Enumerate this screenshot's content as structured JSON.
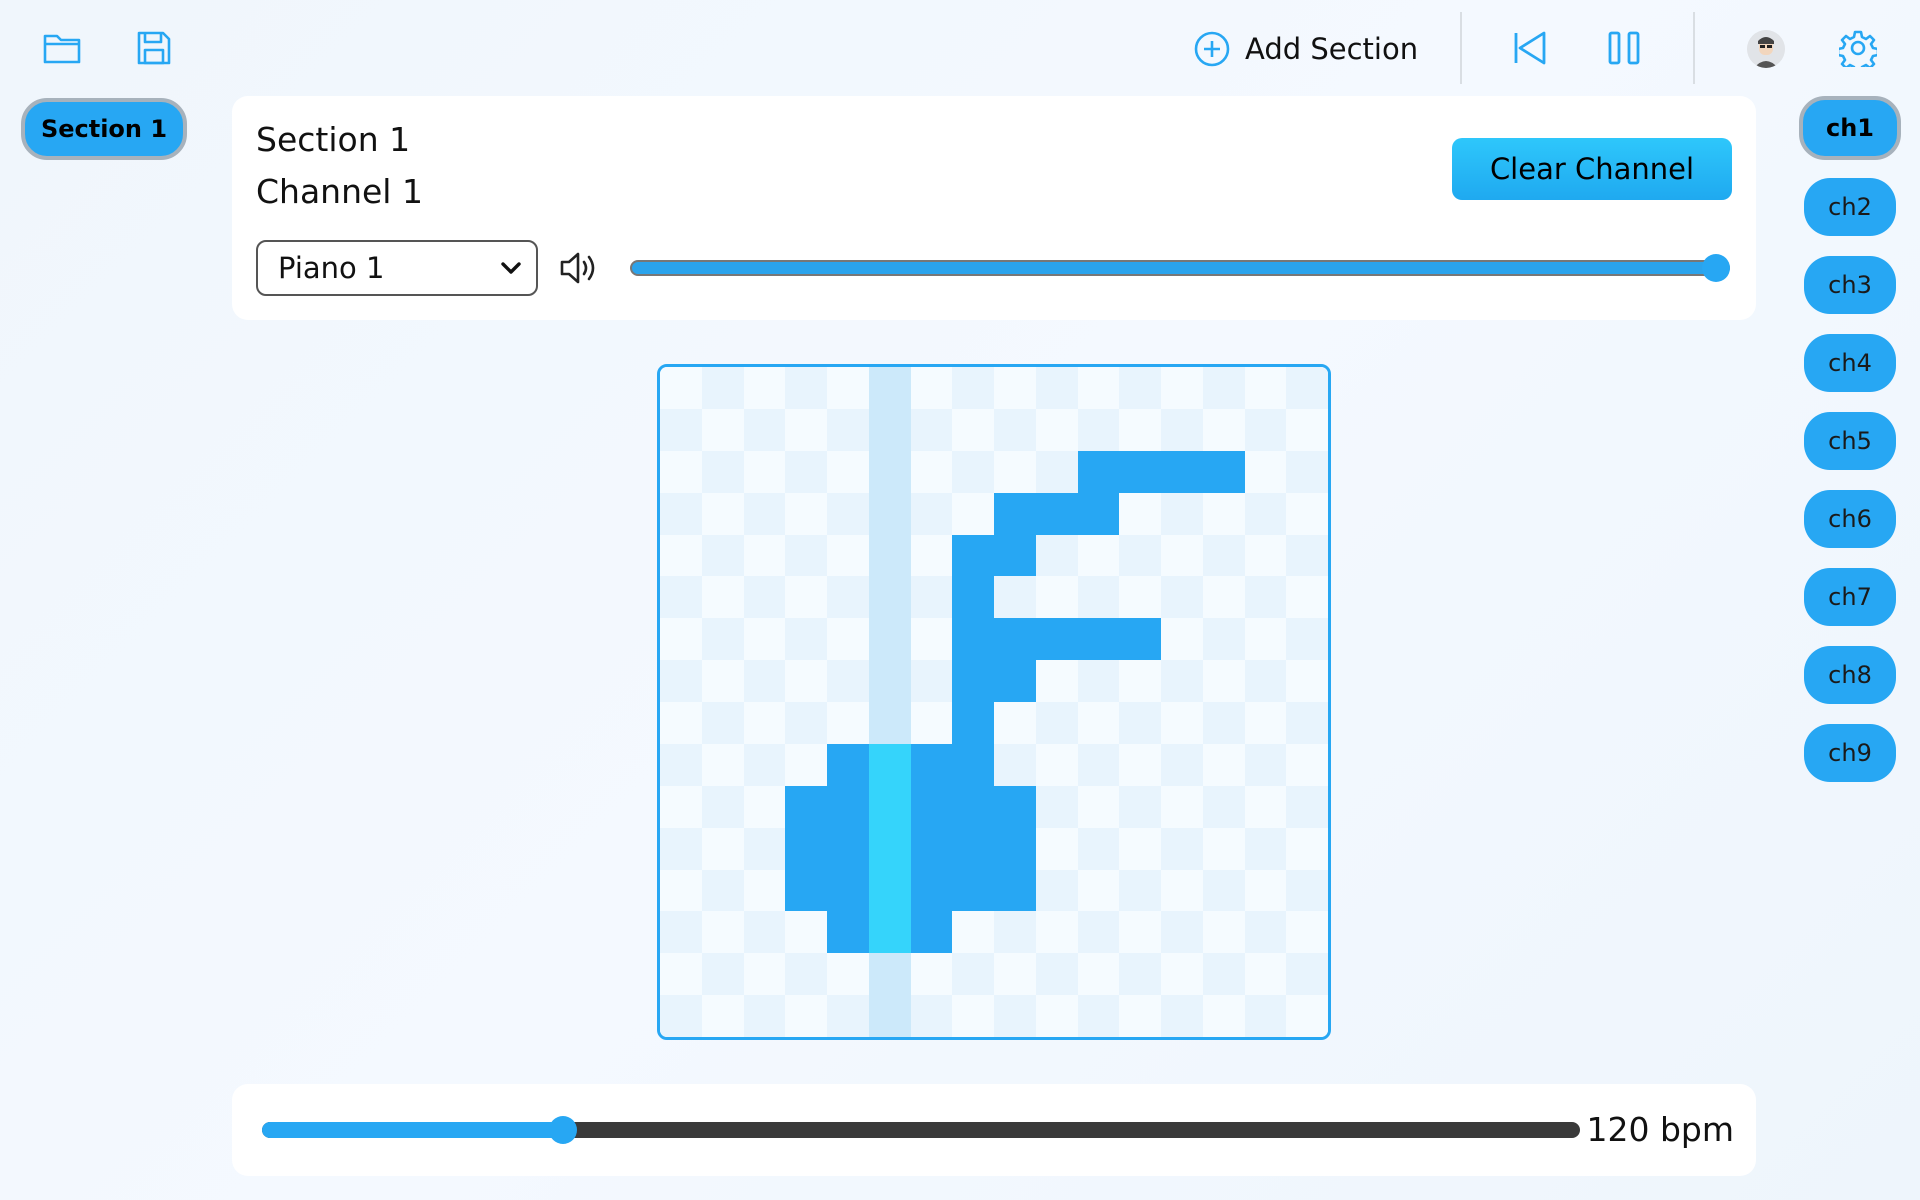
{
  "toolbar": {
    "add_section_label": "Add Section",
    "icons": [
      "folder-icon",
      "save-icon",
      "plus-circle-icon",
      "skip-back-icon",
      "pause-icon",
      "avatar",
      "gear-icon"
    ]
  },
  "sections": [
    {
      "label": "Section 1",
      "active": true
    }
  ],
  "editor": {
    "section_title": "Section 1",
    "channel_title": "Channel 1",
    "clear_label": "Clear Channel",
    "instrument": "Piano 1",
    "volume": 1.0
  },
  "grid": {
    "rows": 16,
    "cols": 16,
    "playhead_col": 5,
    "active_cells": [
      [
        2,
        10
      ],
      [
        2,
        11
      ],
      [
        2,
        12
      ],
      [
        2,
        13
      ],
      [
        3,
        8
      ],
      [
        3,
        9
      ],
      [
        3,
        10
      ],
      [
        4,
        7
      ],
      [
        4,
        8
      ],
      [
        5,
        7
      ],
      [
        6,
        7
      ],
      [
        6,
        8
      ],
      [
        6,
        9
      ],
      [
        6,
        10
      ],
      [
        6,
        11
      ],
      [
        7,
        7
      ],
      [
        7,
        8
      ],
      [
        8,
        7
      ],
      [
        9,
        4
      ],
      [
        9,
        5
      ],
      [
        9,
        6
      ],
      [
        9,
        7
      ],
      [
        10,
        3
      ],
      [
        10,
        4
      ],
      [
        10,
        5
      ],
      [
        10,
        6
      ],
      [
        10,
        7
      ],
      [
        10,
        8
      ],
      [
        11,
        3
      ],
      [
        11,
        4
      ],
      [
        11,
        5
      ],
      [
        11,
        6
      ],
      [
        11,
        7
      ],
      [
        11,
        8
      ],
      [
        12,
        3
      ],
      [
        12,
        4
      ],
      [
        12,
        5
      ],
      [
        12,
        6
      ],
      [
        12,
        7
      ],
      [
        12,
        8
      ],
      [
        13,
        4
      ],
      [
        13,
        5
      ],
      [
        13,
        6
      ]
    ],
    "colors": {
      "active": "#27a7f3",
      "active_playhead": "#35d4fb",
      "playhead": "#cce9fa",
      "light": "#f5fbff",
      "dark": "#e8f4fd"
    }
  },
  "tempo": {
    "bpm_label": "120 bpm",
    "fraction": 0.228
  },
  "channels": [
    {
      "label": "ch1",
      "active": true
    },
    {
      "label": "ch2",
      "active": false
    },
    {
      "label": "ch3",
      "active": false
    },
    {
      "label": "ch4",
      "active": false
    },
    {
      "label": "ch5",
      "active": false
    },
    {
      "label": "ch6",
      "active": false
    },
    {
      "label": "ch7",
      "active": false
    },
    {
      "label": "ch8",
      "active": false
    },
    {
      "label": "ch9",
      "active": false
    }
  ]
}
